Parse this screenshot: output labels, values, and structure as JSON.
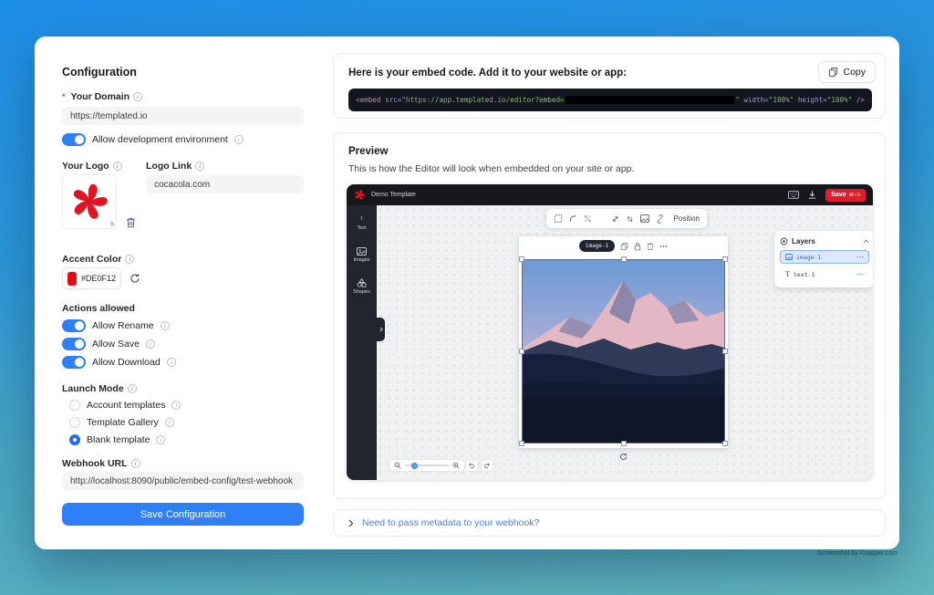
{
  "config": {
    "title": "Configuration",
    "domain_label": "Your Domain",
    "domain_value": "https://templated.io",
    "dev_toggle_label": "Allow development environment",
    "logo_label": "Your Logo",
    "logo_mark": "®",
    "logo_link_label": "Logo Link",
    "logo_link_value": "cocacola.com",
    "accent_label": "Accent Color",
    "accent_value": "#DE0F12",
    "actions_title": "Actions allowed",
    "toggles": [
      "Allow Rename",
      "Allow Save",
      "Allow Download"
    ],
    "launch_label": "Launch Mode",
    "launch_options": [
      "Account templates",
      "Template Gallery",
      "Blank template"
    ],
    "launch_selected": "Blank template",
    "webhook_label": "Webhook URL",
    "webhook_value": "http://localhost:8090/public/embed-config/test-webhook",
    "save_button": "Save Configuration"
  },
  "embed": {
    "heading": "Here is your embed code. Add it to your website or app:",
    "copy_label": "Copy",
    "code": {
      "tag_open": "<embed",
      "attr_src": " src=",
      "str_src": "\"https://app.templated.io/editor?embed=",
      "str_src_end": "\"",
      "attr_width": " width=",
      "str_width": "\"100%\"",
      "attr_height": " height=",
      "str_height": "\"100%\"",
      "tag_close": " />"
    }
  },
  "preview": {
    "title": "Preview",
    "description": "This is how the Editor will look when embedded on your site or app.",
    "editor": {
      "template_name": "Demo Template",
      "save_label": "Save",
      "save_shortcut": "⌘+S",
      "sidebar_items": [
        "Text",
        "Images",
        "Shapes"
      ],
      "position_label": "Position",
      "selection_badge": "image-1",
      "layers_title": "Layers",
      "layer_1": "image-1",
      "layer_2": "text-1"
    }
  },
  "footer": {
    "metadata_link": "Need to pass metadata to your webhook?"
  },
  "credit": "Screenshot by Knapper.com",
  "colors": {
    "accent_blue": "#2f80f7",
    "brand_red": "#de0f12",
    "save_red": "#e11d2d",
    "link_blue": "#3b82f6",
    "code_bg": "#14161f"
  }
}
